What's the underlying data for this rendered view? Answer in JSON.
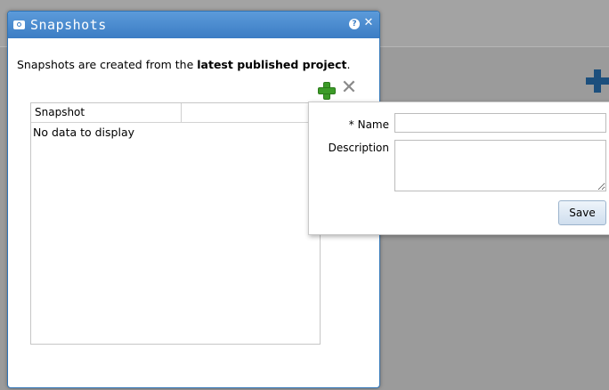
{
  "dialog": {
    "title": "Snapshots",
    "title_icon": "camera-icon",
    "help_icon": "question-icon",
    "close_icon": "close-icon",
    "info_prefix": "Snapshots are created from the ",
    "info_bold": "latest published project",
    "info_suffix": ".",
    "add_icon": "add-icon",
    "delete_icon": "delete-icon",
    "table": {
      "columns": [
        "Snapshot",
        ""
      ],
      "empty_message": "No data to display"
    }
  },
  "form": {
    "name_label": "* Name",
    "name_value": "",
    "description_label": "Description",
    "description_value": "",
    "save_label": "Save"
  },
  "colors": {
    "title_bar": "#3b7dc4",
    "add_green": "#3c9b28",
    "background_plus": "#1c4f7d"
  }
}
